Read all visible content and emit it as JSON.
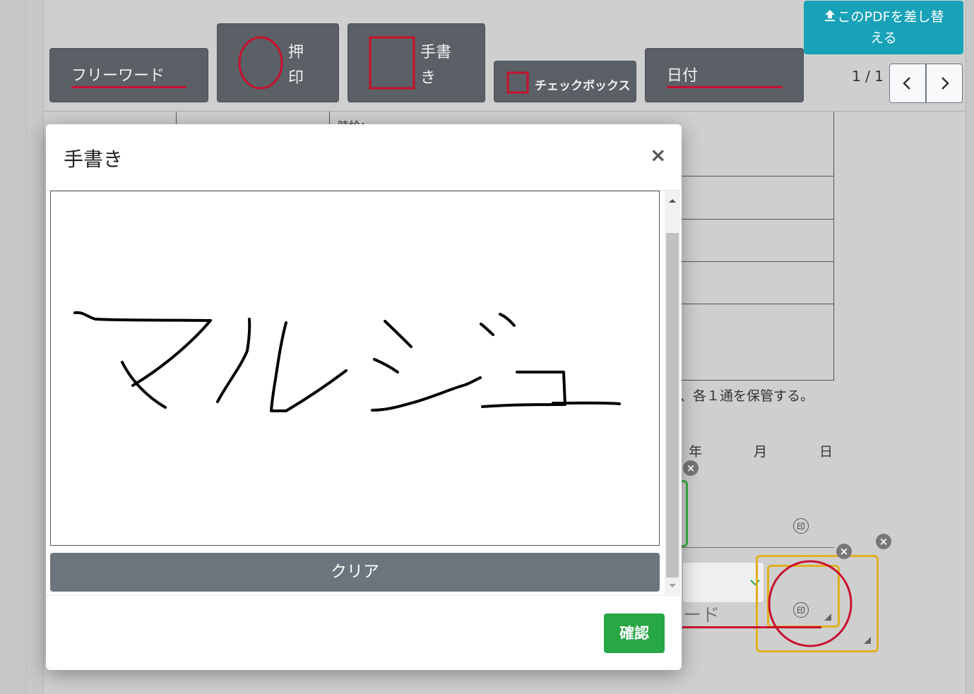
{
  "toolbar": {
    "freeword_label": "フリーワード",
    "stamp_label_1": "押",
    "stamp_label_2": "印",
    "handwriting_label_1": "手書",
    "handwriting_label_2": "き",
    "checkbox_label": "チェックボックス",
    "date_label": "日付",
    "upload_label_1": "このPDFを差し替",
    "upload_label_2": "える",
    "pager_text": "1 / 1"
  },
  "document": {
    "partial_text_top": "時給：",
    "storage_note": "、各１通を保管する。",
    "year": "年",
    "month": "月",
    "day": "日",
    "seal_char": "印",
    "field_partial": "ード"
  },
  "modal": {
    "title": "手書き",
    "close": "×",
    "clear_label": "クリア",
    "confirm_label": "確認",
    "handwriting_content": "マルジュ"
  },
  "colors": {
    "toolbar_button": "#5a6066",
    "accent_red": "#c8102e",
    "upload_teal": "#17a2b8",
    "confirm_green": "#28a745",
    "clear_gray": "#6c757d",
    "field_yellow": "#e0b020"
  }
}
